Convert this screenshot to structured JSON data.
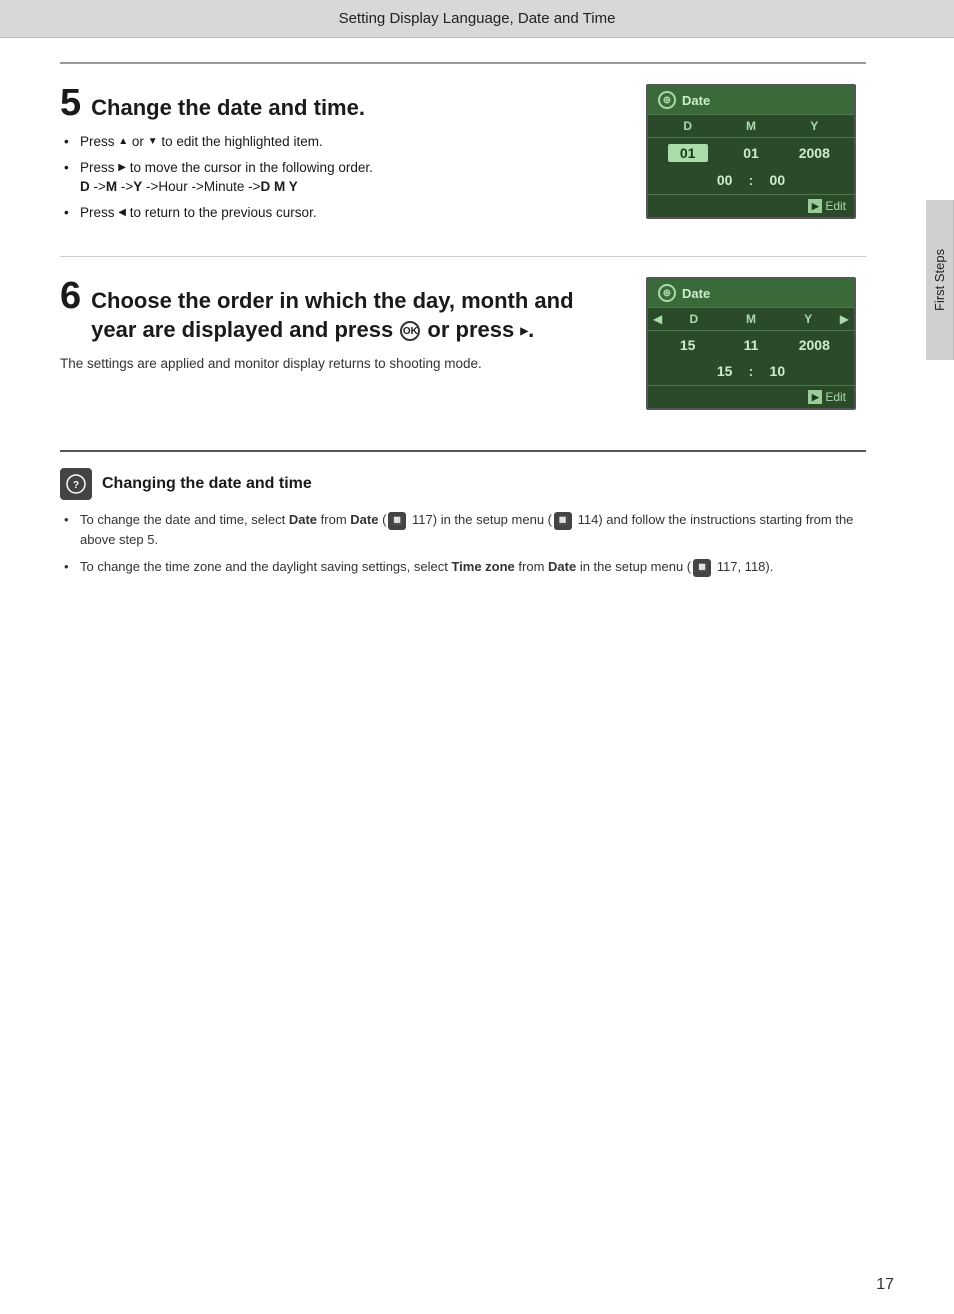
{
  "page": {
    "header_title": "Setting Display Language, Date and Time",
    "sidebar_label": "First Steps",
    "page_number": "17"
  },
  "step5": {
    "number": "5",
    "title": "Change the date and time.",
    "bullets": [
      "Press ▲ or ▼ to edit the highlighted item.",
      "Press ▶ to move the cursor in the following order. D ->M ->Y ->Hour ->Minute ->D M Y",
      "Press ◀ to return to the previous cursor."
    ],
    "lcd": {
      "header": "Date",
      "col_d": "D",
      "col_m": "M",
      "col_y": "Y",
      "date_d": "01",
      "date_m": "01",
      "date_y": "2008",
      "time_h": "00",
      "time_sep": ":",
      "time_m": "00",
      "footer": "Edit"
    }
  },
  "step6": {
    "number": "6",
    "title_line1": "Choose the order in which the day, month and",
    "title_line2": "year are displayed and press",
    "title_line3": "or press ▶.",
    "body": "The settings are applied and monitor display returns to shooting mode.",
    "lcd": {
      "header": "Date",
      "col_d": "D",
      "col_m": "M",
      "col_y": "Y",
      "date_d": "15",
      "date_m": "11",
      "date_y": "2008",
      "time_h": "15",
      "time_sep": ":",
      "time_m": "10",
      "footer": "Edit"
    }
  },
  "note": {
    "title": "Changing the date and time",
    "bullets": [
      "To change the date and time, select Date from Date (🔲 117) in the setup menu (🔲 114) and follow the instructions starting from the above step 5.",
      "To change the time zone and the daylight saving settings, select Time zone from Date in the setup menu (🔲 117, 118)."
    ]
  }
}
